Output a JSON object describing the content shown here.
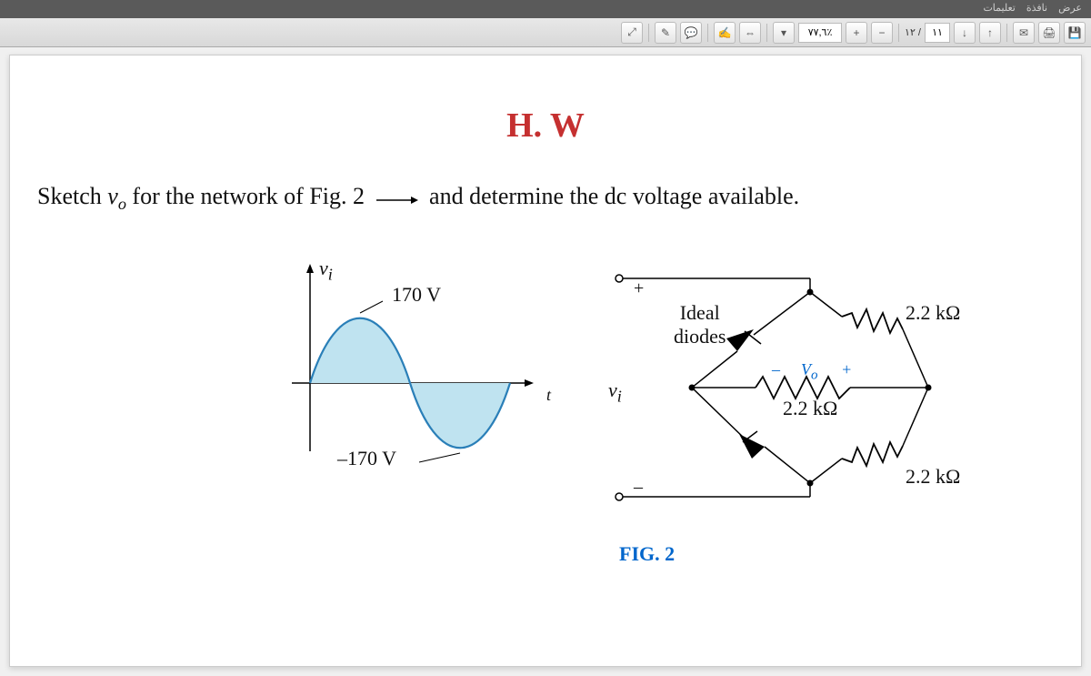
{
  "menubar": {
    "item1": "عرض",
    "item2": "نافذة",
    "item3": "تعليمات"
  },
  "toolbar": {
    "zoom": "٧٧,٦٪",
    "page_current": "١١",
    "page_total": "١٢ /"
  },
  "content": {
    "title": "H. W",
    "problem_pre": "Sketch ",
    "problem_var": "v",
    "problem_sub": "o",
    "problem_mid": " for the network of Fig. 2",
    "problem_post": "and determine the dc voltage available.",
    "fig_label": "FIG. 2",
    "wave": {
      "vi_label": "v",
      "vi_sub": "i",
      "pos_peak": "170 V",
      "neg_peak": "–170 V",
      "t_label": "t"
    },
    "circuit": {
      "plus": "+",
      "minus": "–",
      "vi": "v",
      "vi_sub": "i",
      "ideal": "Ideal",
      "diodes": "diodes",
      "vo": "V",
      "vo_sub": "o",
      "vo_minus": "–",
      "vo_plus": "+",
      "r1": "2.2 kΩ",
      "r2": "2.2 kΩ",
      "r3": "2.2 kΩ"
    }
  }
}
